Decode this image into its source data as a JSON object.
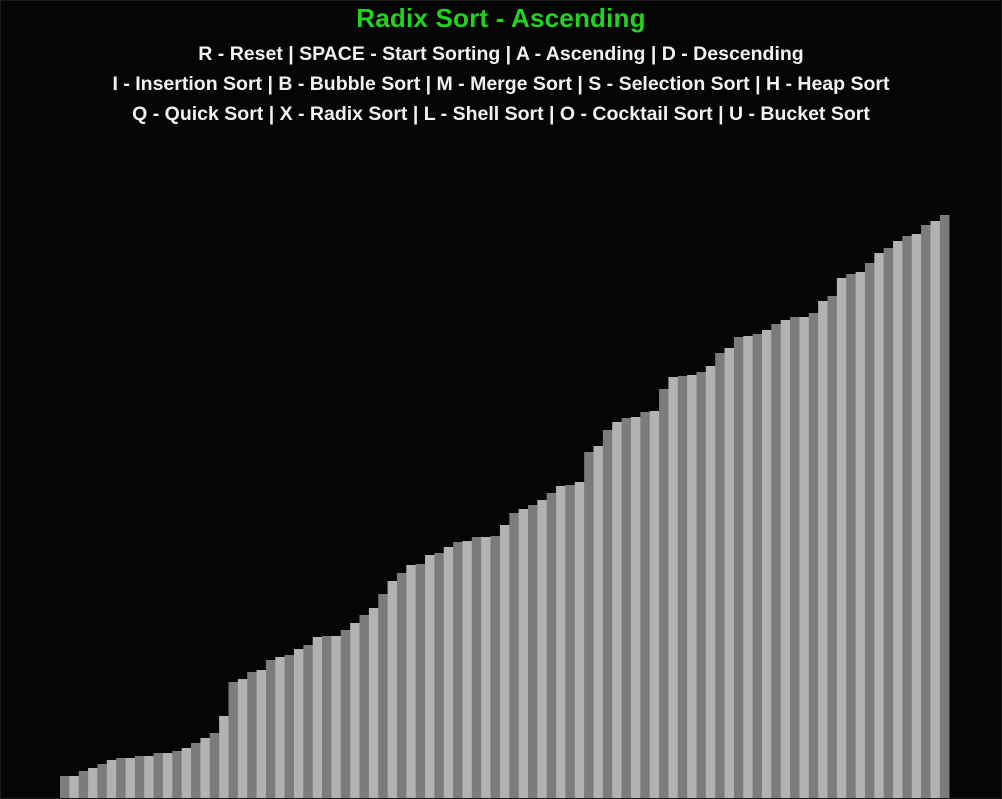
{
  "window": {
    "title": "Radix Sort - Ascending"
  },
  "controls": {
    "line1": "R - Reset | SPACE - Start Sorting | A - Ascending | D - Descending",
    "line2": "I - Insertion Sort | B - Bubble Sort | M - Merge Sort | S - Selection Sort | H - Heap Sort",
    "line3": "Q - Quick Sort | X - Radix Sort | L - Shell Sort | O - Cocktail Sort | U - Bucket Sort"
  },
  "state": {
    "algorithm": "Radix Sort",
    "order": "Ascending"
  },
  "colors": {
    "background": "#050505",
    "title": "#1fd41f",
    "help_text": "#f2f2f2",
    "bar_dark": "#7c7c7c",
    "bar_light": "#b2b2b2"
  },
  "chart_data": {
    "type": "bar",
    "series": [
      {
        "values": [
          24,
          24,
          29,
          32,
          36,
          40,
          42,
          42,
          44,
          44,
          47,
          47,
          49,
          52,
          57,
          62,
          67,
          84,
          118,
          121,
          128,
          130,
          140,
          143,
          145,
          151,
          155,
          163,
          164,
          164,
          170,
          177,
          185,
          192,
          206,
          219,
          227,
          235,
          236,
          245,
          247,
          253,
          258,
          259,
          263,
          263,
          264,
          275,
          287,
          291,
          295,
          300,
          307,
          314,
          315,
          318,
          348,
          354,
          370,
          378,
          382,
          383,
          388,
          389,
          411,
          423,
          424,
          425,
          428,
          434,
          447,
          452,
          463,
          464,
          466,
          470,
          476,
          480,
          483,
          483,
          487,
          499,
          504,
          522,
          526,
          528,
          537,
          547,
          552,
          559,
          564,
          566,
          575,
          579,
          585
        ]
      }
    ],
    "ylim": [
      0,
      600
    ]
  }
}
